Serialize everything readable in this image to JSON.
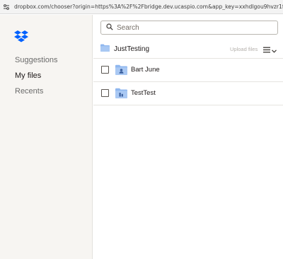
{
  "browser": {
    "url": "dropbox.com/chooser?origin=https%3A%2F%2Fbridge.dev.ucaspio.com&app_key=xxhdlgou9hvzr1f&link_ty..."
  },
  "sidebar": {
    "items": [
      {
        "label": "Suggestions"
      },
      {
        "label": "My files"
      },
      {
        "label": "Recents"
      }
    ]
  },
  "search": {
    "placeholder": "Search"
  },
  "folder": {
    "name": "JustTesting",
    "upload_label": "Upload files"
  },
  "files": [
    {
      "name": "Bart June",
      "icon": "shared-folder-icon"
    },
    {
      "name": "TestTest",
      "icon": "team-folder-icon"
    }
  ],
  "colors": {
    "brand": "#0061fe",
    "folder": "#8fb7ef",
    "sidebar_bg": "#f7f5f2"
  }
}
